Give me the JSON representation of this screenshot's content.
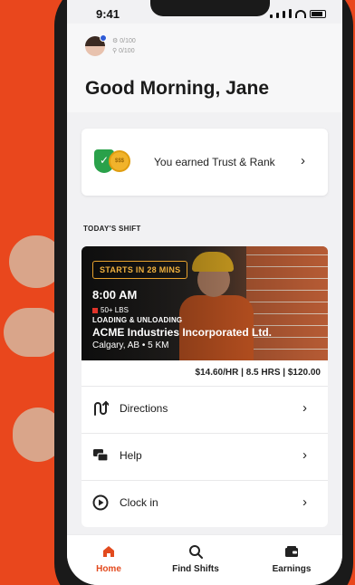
{
  "status_bar": {
    "time": "9:41"
  },
  "header": {
    "stat_1": "0/100",
    "stat_2": "0/100",
    "greeting": "Good Morning, Jane"
  },
  "trust_card": {
    "label": "You earned Trust & Rank",
    "coin_text": "$$$"
  },
  "section_label": "TODAY'S SHIFT",
  "shift": {
    "starts_badge": "STARTS IN 28 MINS",
    "time": "8:00 AM",
    "weight": "50+ LBS",
    "category": "LOADING & UNLOADING",
    "company": "ACME Industries Incorporated Ltd.",
    "location": "Calgary, AB • 5 KM",
    "pay": "$14.60/HR | 8.5 HRS | $120.00"
  },
  "actions": [
    {
      "label": "Directions",
      "icon": "directions-icon"
    },
    {
      "label": "Help",
      "icon": "chat-icon"
    },
    {
      "label": "Clock in",
      "icon": "play-circle-icon"
    }
  ],
  "tabs": [
    {
      "label": "Home",
      "icon": "home-icon",
      "active": true
    },
    {
      "label": "Find Shifts",
      "icon": "search-icon",
      "active": false
    },
    {
      "label": "Earnings",
      "icon": "wallet-icon",
      "active": false
    }
  ],
  "colors": {
    "background": "#e9471d",
    "accent": "#e24a1e",
    "badge": "#e6a12d",
    "shield": "#2aa14a"
  }
}
